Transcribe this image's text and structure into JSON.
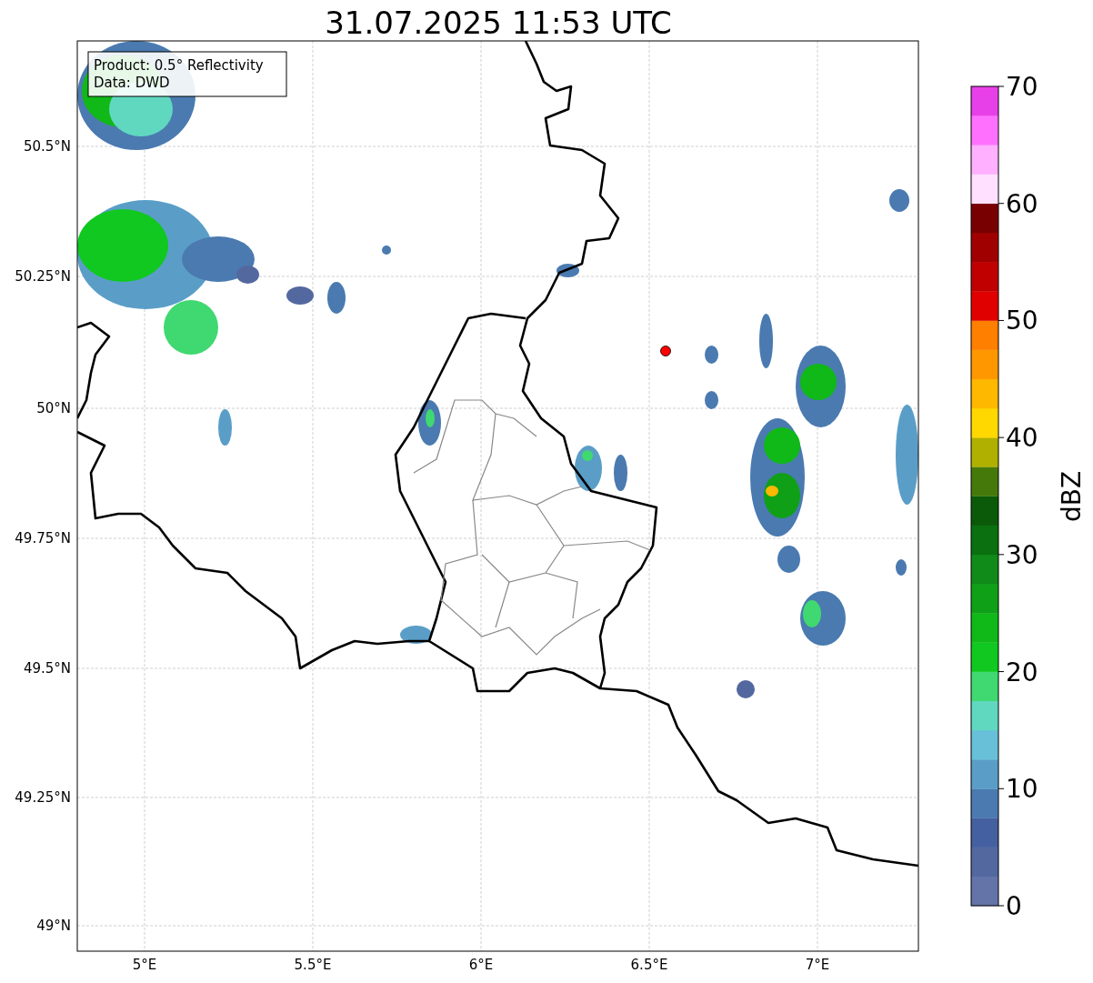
{
  "title": "31.07.2025 11:53 UTC",
  "map": {
    "info_lines": [
      "Product: 0.5° Reflectivity",
      "Data: DWD"
    ],
    "lat_labels": [
      "50.5°N",
      "50.25°N",
      "50°N",
      "49.75°N",
      "49.5°N",
      "49.25°N",
      "49°N"
    ],
    "lon_labels": [
      "5°E",
      "5.5°E",
      "6°E",
      "6.5°E",
      "7°E"
    ]
  },
  "colorbar": {
    "label": "dBZ",
    "ticks": [
      "70",
      "60",
      "50",
      "40",
      "30",
      "20",
      "10",
      "0"
    ],
    "segments": [
      {
        "color": "#6474a8"
      },
      {
        "color": "#5468a0"
      },
      {
        "color": "#4560a0"
      },
      {
        "color": "#4a7ab0"
      },
      {
        "color": "#5a9ec8"
      },
      {
        "color": "#68c0d8"
      },
      {
        "color": "#60d8c0"
      },
      {
        "color": "#40d870"
      },
      {
        "color": "#10c820"
      },
      {
        "color": "#10b818"
      },
      {
        "color": "#10a018"
      },
      {
        "color": "#108a18"
      },
      {
        "color": "#0a7010"
      },
      {
        "color": "#0a5a0a"
      },
      {
        "color": "#457a0a"
      },
      {
        "color": "#b0b000"
      },
      {
        "color": "#ffd800"
      },
      {
        "color": "#ffb800"
      },
      {
        "color": "#ff9800"
      },
      {
        "color": "#ff7f00"
      },
      {
        "color": "#e00000"
      },
      {
        "color": "#c00000"
      },
      {
        "color": "#a00000"
      },
      {
        "color": "#780000"
      },
      {
        "color": "#ffe0ff"
      },
      {
        "color": "#ffb0ff"
      },
      {
        "color": "#ff70ff"
      },
      {
        "color": "#e840e8"
      }
    ]
  }
}
